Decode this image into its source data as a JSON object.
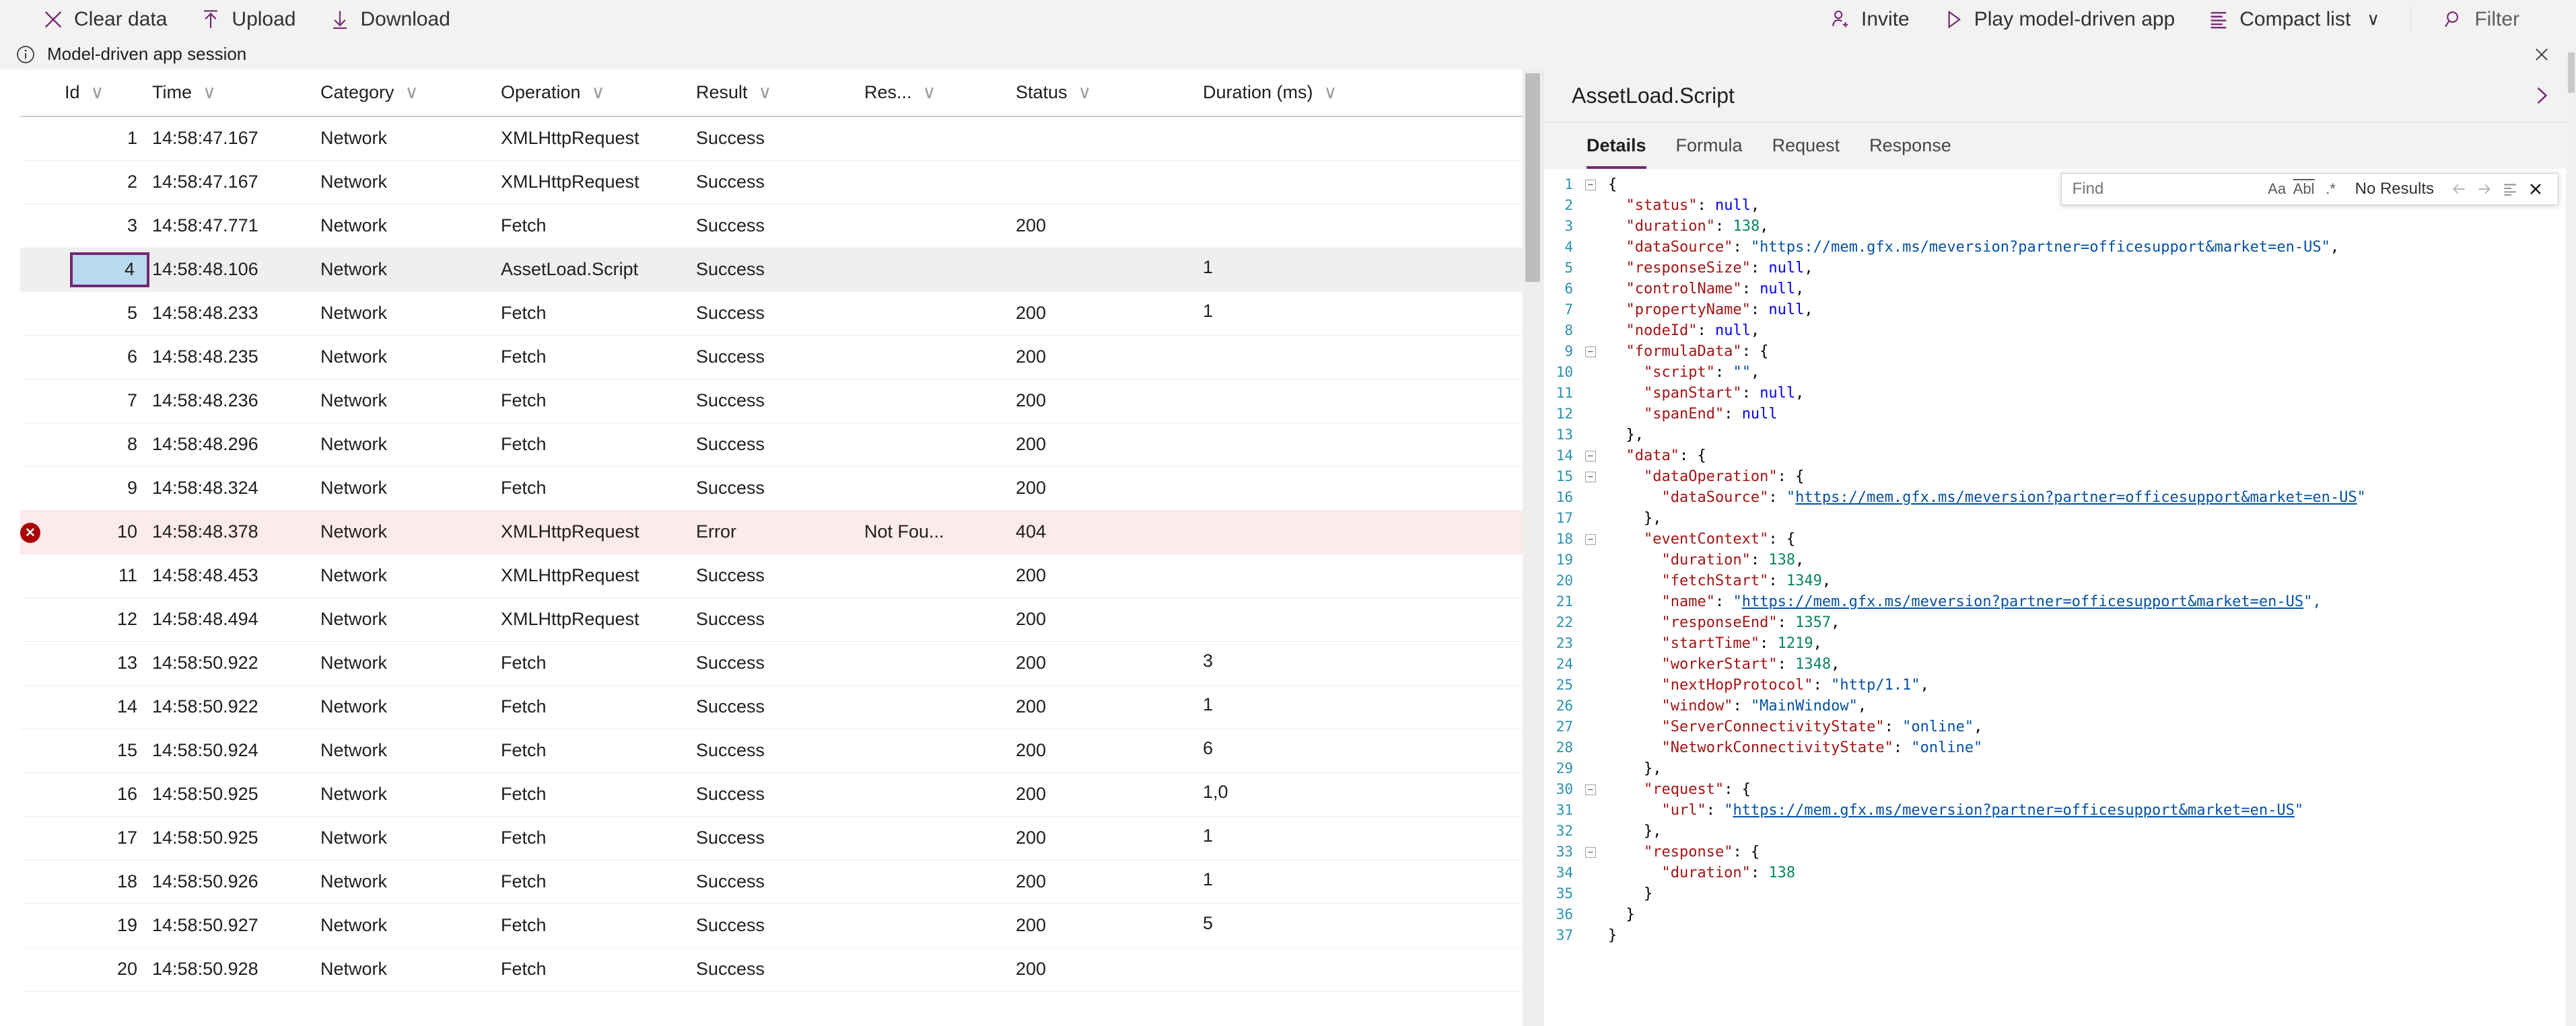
{
  "toolbar": {
    "left_items": [
      {
        "icon": "clear-icon",
        "label": "Clear data"
      },
      {
        "icon": "upload-icon",
        "label": "Upload"
      },
      {
        "icon": "download-icon",
        "label": "Download"
      }
    ],
    "right_items": [
      {
        "icon": "invite-person-icon",
        "label": "Invite"
      },
      {
        "icon": "play-icon",
        "label": "Play model-driven app"
      },
      {
        "icon": "list-icon",
        "label": "Compact list",
        "caret": "∨"
      },
      {
        "icon": "search-icon",
        "label": "Filter"
      }
    ]
  },
  "session_bar": {
    "icon": "info-icon",
    "text": "Model-driven app session",
    "close_icon": "close-icon"
  },
  "table": {
    "columns": [
      {
        "key": "err",
        "label": ""
      },
      {
        "key": "id",
        "label": "Id"
      },
      {
        "key": "time",
        "label": "Time"
      },
      {
        "key": "cat",
        "label": "Category"
      },
      {
        "key": "op",
        "label": "Operation"
      },
      {
        "key": "res",
        "label": "Result"
      },
      {
        "key": "ressz",
        "label": "Res..."
      },
      {
        "key": "stat",
        "label": "Status"
      },
      {
        "key": "dur",
        "label": "Duration (ms)"
      }
    ],
    "sort_chevron": "∨",
    "rows": [
      {
        "err": "",
        "id": "1",
        "time": "14:58:47.167",
        "cat": "Network",
        "op": "XMLHttpRequest",
        "res": "Success",
        "ressz": "",
        "stat": "",
        "dur": ""
      },
      {
        "err": "",
        "id": "2",
        "time": "14:58:47.167",
        "cat": "Network",
        "op": "XMLHttpRequest",
        "res": "Success",
        "ressz": "",
        "stat": "",
        "dur": ""
      },
      {
        "err": "",
        "id": "3",
        "time": "14:58:47.771",
        "cat": "Network",
        "op": "Fetch",
        "res": "Success",
        "ressz": "",
        "stat": "200",
        "dur": ""
      },
      {
        "err": "",
        "id": "4",
        "time": "14:58:48.106",
        "cat": "Network",
        "op": "AssetLoad.Script",
        "res": "Success",
        "ressz": "",
        "stat": "",
        "dur": "1"
      },
      {
        "err": "",
        "id": "5",
        "time": "14:58:48.233",
        "cat": "Network",
        "op": "Fetch",
        "res": "Success",
        "ressz": "",
        "stat": "200",
        "dur": "1"
      },
      {
        "err": "",
        "id": "6",
        "time": "14:58:48.235",
        "cat": "Network",
        "op": "Fetch",
        "res": "Success",
        "ressz": "",
        "stat": "200",
        "dur": ""
      },
      {
        "err": "",
        "id": "7",
        "time": "14:58:48.236",
        "cat": "Network",
        "op": "Fetch",
        "res": "Success",
        "ressz": "",
        "stat": "200",
        "dur": ""
      },
      {
        "err": "",
        "id": "8",
        "time": "14:58:48.296",
        "cat": "Network",
        "op": "Fetch",
        "res": "Success",
        "ressz": "",
        "stat": "200",
        "dur": ""
      },
      {
        "err": "",
        "id": "9",
        "time": "14:58:48.324",
        "cat": "Network",
        "op": "Fetch",
        "res": "Success",
        "ressz": "",
        "stat": "200",
        "dur": ""
      },
      {
        "err": "error-icon",
        "id": "10",
        "time": "14:58:48.378",
        "cat": "Network",
        "op": "XMLHttpRequest",
        "res": "Error",
        "ressz": "Not Fou...",
        "stat": "404",
        "dur": ""
      },
      {
        "err": "",
        "id": "11",
        "time": "14:58:48.453",
        "cat": "Network",
        "op": "XMLHttpRequest",
        "res": "Success",
        "ressz": "",
        "stat": "200",
        "dur": ""
      },
      {
        "err": "",
        "id": "12",
        "time": "14:58:48.494",
        "cat": "Network",
        "op": "XMLHttpRequest",
        "res": "Success",
        "ressz": "",
        "stat": "200",
        "dur": ""
      },
      {
        "err": "",
        "id": "13",
        "time": "14:58:50.922",
        "cat": "Network",
        "op": "Fetch",
        "res": "Success",
        "ressz": "",
        "stat": "200",
        "dur": "3"
      },
      {
        "err": "",
        "id": "14",
        "time": "14:58:50.922",
        "cat": "Network",
        "op": "Fetch",
        "res": "Success",
        "ressz": "",
        "stat": "200",
        "dur": "1"
      },
      {
        "err": "",
        "id": "15",
        "time": "14:58:50.924",
        "cat": "Network",
        "op": "Fetch",
        "res": "Success",
        "ressz": "",
        "stat": "200",
        "dur": "6"
      },
      {
        "err": "",
        "id": "16",
        "time": "14:58:50.925",
        "cat": "Network",
        "op": "Fetch",
        "res": "Success",
        "ressz": "",
        "stat": "200",
        "dur": "1,0"
      },
      {
        "err": "",
        "id": "17",
        "time": "14:58:50.925",
        "cat": "Network",
        "op": "Fetch",
        "res": "Success",
        "ressz": "",
        "stat": "200",
        "dur": "1"
      },
      {
        "err": "",
        "id": "18",
        "time": "14:58:50.926",
        "cat": "Network",
        "op": "Fetch",
        "res": "Success",
        "ressz": "",
        "stat": "200",
        "dur": "1"
      },
      {
        "err": "",
        "id": "19",
        "time": "14:58:50.927",
        "cat": "Network",
        "op": "Fetch",
        "res": "Success",
        "ressz": "",
        "stat": "200",
        "dur": "5"
      },
      {
        "err": "",
        "id": "20",
        "time": "14:58:50.928",
        "cat": "Network",
        "op": "Fetch",
        "res": "Success",
        "ressz": "",
        "stat": "200",
        "dur": ""
      }
    ],
    "selected_row_index": 3,
    "error_row_index": 9
  },
  "details": {
    "title": "AssetLoad.Script",
    "expand_icon": "chevron-right-icon",
    "tabs": [
      {
        "label": "Details",
        "active": true
      },
      {
        "label": "Formula",
        "active": false
      },
      {
        "label": "Request",
        "active": false
      },
      {
        "label": "Response",
        "active": false
      }
    ],
    "find": {
      "placeholder": "Find",
      "value": "",
      "match_case_label": "Aa",
      "whole_word_label": "Abl",
      "regex_label": ".*",
      "results_text": "No Results",
      "prev_icon": "arrow-left-icon",
      "next_icon": "arrow-right-icon",
      "find_in_selection_icon": "selection-icon",
      "close_icon": "close-icon"
    },
    "json_lines": [
      {
        "n": 1,
        "fold": "-",
        "indent": 0,
        "segs": [
          {
            "t": "{",
            "c": "p"
          }
        ]
      },
      {
        "n": 2,
        "fold": "",
        "indent": 1,
        "segs": [
          {
            "t": "  \"status\"",
            "c": "k"
          },
          {
            "t": ": ",
            "c": "p"
          },
          {
            "t": "null",
            "c": "b"
          },
          {
            "t": ",",
            "c": "p"
          }
        ]
      },
      {
        "n": 3,
        "fold": "",
        "indent": 1,
        "segs": [
          {
            "t": "  \"duration\"",
            "c": "k"
          },
          {
            "t": ": ",
            "c": "p"
          },
          {
            "t": "138",
            "c": "n"
          },
          {
            "t": ",",
            "c": "p"
          }
        ]
      },
      {
        "n": 4,
        "fold": "",
        "indent": 1,
        "segs": [
          {
            "t": "  \"dataSource\"",
            "c": "k"
          },
          {
            "t": ": ",
            "c": "p"
          },
          {
            "t": "\"https://mem.gfx.ms/meversion?partner=officesupport&market=en-US\"",
            "c": "s"
          },
          {
            "t": ",",
            "c": "p"
          }
        ]
      },
      {
        "n": 5,
        "fold": "",
        "indent": 1,
        "segs": [
          {
            "t": "  \"responseSize\"",
            "c": "k"
          },
          {
            "t": ": ",
            "c": "p"
          },
          {
            "t": "null",
            "c": "b"
          },
          {
            "t": ",",
            "c": "p"
          }
        ]
      },
      {
        "n": 6,
        "fold": "",
        "indent": 1,
        "segs": [
          {
            "t": "  \"controlName\"",
            "c": "k"
          },
          {
            "t": ": ",
            "c": "p"
          },
          {
            "t": "null",
            "c": "b"
          },
          {
            "t": ",",
            "c": "p"
          }
        ]
      },
      {
        "n": 7,
        "fold": "",
        "indent": 1,
        "segs": [
          {
            "t": "  \"propertyName\"",
            "c": "k"
          },
          {
            "t": ": ",
            "c": "p"
          },
          {
            "t": "null",
            "c": "b"
          },
          {
            "t": ",",
            "c": "p"
          }
        ]
      },
      {
        "n": 8,
        "fold": "",
        "indent": 1,
        "segs": [
          {
            "t": "  \"nodeId\"",
            "c": "k"
          },
          {
            "t": ": ",
            "c": "p"
          },
          {
            "t": "null",
            "c": "b"
          },
          {
            "t": ",",
            "c": "p"
          }
        ]
      },
      {
        "n": 9,
        "fold": "-",
        "indent": 1,
        "segs": [
          {
            "t": "  \"formulaData\"",
            "c": "k"
          },
          {
            "t": ": {",
            "c": "p"
          }
        ]
      },
      {
        "n": 10,
        "fold": "",
        "indent": 2,
        "segs": [
          {
            "t": "    \"script\"",
            "c": "k"
          },
          {
            "t": ": ",
            "c": "p"
          },
          {
            "t": "\"\"",
            "c": "s"
          },
          {
            "t": ",",
            "c": "p"
          }
        ]
      },
      {
        "n": 11,
        "fold": "",
        "indent": 2,
        "segs": [
          {
            "t": "    \"spanStart\"",
            "c": "k"
          },
          {
            "t": ": ",
            "c": "p"
          },
          {
            "t": "null",
            "c": "b"
          },
          {
            "t": ",",
            "c": "p"
          }
        ]
      },
      {
        "n": 12,
        "fold": "",
        "indent": 2,
        "segs": [
          {
            "t": "    \"spanEnd\"",
            "c": "k"
          },
          {
            "t": ": ",
            "c": "p"
          },
          {
            "t": "null",
            "c": "b"
          }
        ]
      },
      {
        "n": 13,
        "fold": "",
        "indent": 1,
        "segs": [
          {
            "t": "  },",
            "c": "p"
          }
        ]
      },
      {
        "n": 14,
        "fold": "-",
        "indent": 1,
        "segs": [
          {
            "t": "  \"data\"",
            "c": "k"
          },
          {
            "t": ": {",
            "c": "p"
          }
        ]
      },
      {
        "n": 15,
        "fold": "-",
        "indent": 2,
        "segs": [
          {
            "t": "    \"dataOperation\"",
            "c": "k"
          },
          {
            "t": ": {",
            "c": "p"
          }
        ]
      },
      {
        "n": 16,
        "fold": "",
        "indent": 3,
        "segs": [
          {
            "t": "      \"dataSource\"",
            "c": "k"
          },
          {
            "t": ": ",
            "c": "p"
          },
          {
            "t": "\"",
            "c": "s"
          },
          {
            "t": "https://mem.gfx.ms/meversion?partner=officesupport&market=en-US",
            "c": "lnk"
          },
          {
            "t": "\"",
            "c": "s"
          }
        ]
      },
      {
        "n": 17,
        "fold": "",
        "indent": 2,
        "segs": [
          {
            "t": "    },",
            "c": "p"
          }
        ]
      },
      {
        "n": 18,
        "fold": "-",
        "indent": 2,
        "segs": [
          {
            "t": "    \"eventContext\"",
            "c": "k"
          },
          {
            "t": ": {",
            "c": "p"
          }
        ]
      },
      {
        "n": 19,
        "fold": "",
        "indent": 3,
        "segs": [
          {
            "t": "      \"duration\"",
            "c": "k"
          },
          {
            "t": ": ",
            "c": "p"
          },
          {
            "t": "138",
            "c": "n"
          },
          {
            "t": ",",
            "c": "p"
          }
        ]
      },
      {
        "n": 20,
        "fold": "",
        "indent": 3,
        "segs": [
          {
            "t": "      \"fetchStart\"",
            "c": "k"
          },
          {
            "t": ": ",
            "c": "p"
          },
          {
            "t": "1349",
            "c": "n"
          },
          {
            "t": ",",
            "c": "p"
          }
        ]
      },
      {
        "n": 21,
        "fold": "",
        "indent": 3,
        "segs": [
          {
            "t": "      \"name\"",
            "c": "k"
          },
          {
            "t": ": ",
            "c": "p"
          },
          {
            "t": "\"",
            "c": "s"
          },
          {
            "t": "https://mem.gfx.ms/meversion?partner=officesupport&market=en-US",
            "c": "lnk"
          },
          {
            "t": "\",",
            "c": "s"
          }
        ]
      },
      {
        "n": 22,
        "fold": "",
        "indent": 3,
        "segs": [
          {
            "t": "      \"responseEnd\"",
            "c": "k"
          },
          {
            "t": ": ",
            "c": "p"
          },
          {
            "t": "1357",
            "c": "n"
          },
          {
            "t": ",",
            "c": "p"
          }
        ]
      },
      {
        "n": 23,
        "fold": "",
        "indent": 3,
        "segs": [
          {
            "t": "      \"startTime\"",
            "c": "k"
          },
          {
            "t": ": ",
            "c": "p"
          },
          {
            "t": "1219",
            "c": "n"
          },
          {
            "t": ",",
            "c": "p"
          }
        ]
      },
      {
        "n": 24,
        "fold": "",
        "indent": 3,
        "segs": [
          {
            "t": "      \"workerStart\"",
            "c": "k"
          },
          {
            "t": ": ",
            "c": "p"
          },
          {
            "t": "1348",
            "c": "n"
          },
          {
            "t": ",",
            "c": "p"
          }
        ]
      },
      {
        "n": 25,
        "fold": "",
        "indent": 3,
        "segs": [
          {
            "t": "      \"nextHopProtocol\"",
            "c": "k"
          },
          {
            "t": ": ",
            "c": "p"
          },
          {
            "t": "\"http/1.1\"",
            "c": "s"
          },
          {
            "t": ",",
            "c": "p"
          }
        ]
      },
      {
        "n": 26,
        "fold": "",
        "indent": 3,
        "segs": [
          {
            "t": "      \"window\"",
            "c": "k"
          },
          {
            "t": ": ",
            "c": "p"
          },
          {
            "t": "\"MainWindow\"",
            "c": "s"
          },
          {
            "t": ",",
            "c": "p"
          }
        ]
      },
      {
        "n": 27,
        "fold": "",
        "indent": 3,
        "segs": [
          {
            "t": "      \"ServerConnectivityState\"",
            "c": "k"
          },
          {
            "t": ": ",
            "c": "p"
          },
          {
            "t": "\"online\"",
            "c": "s"
          },
          {
            "t": ",",
            "c": "p"
          }
        ]
      },
      {
        "n": 28,
        "fold": "",
        "indent": 3,
        "segs": [
          {
            "t": "      \"NetworkConnectivityState\"",
            "c": "k"
          },
          {
            "t": ": ",
            "c": "p"
          },
          {
            "t": "\"online\"",
            "c": "s"
          }
        ]
      },
      {
        "n": 29,
        "fold": "",
        "indent": 2,
        "segs": [
          {
            "t": "    },",
            "c": "p"
          }
        ]
      },
      {
        "n": 30,
        "fold": "-",
        "indent": 2,
        "segs": [
          {
            "t": "    \"request\"",
            "c": "k"
          },
          {
            "t": ": {",
            "c": "p"
          }
        ]
      },
      {
        "n": 31,
        "fold": "",
        "indent": 3,
        "segs": [
          {
            "t": "      \"url\"",
            "c": "k"
          },
          {
            "t": ": ",
            "c": "p"
          },
          {
            "t": "\"",
            "c": "s"
          },
          {
            "t": "https://mem.gfx.ms/meversion?partner=officesupport&market=en-US",
            "c": "lnk"
          },
          {
            "t": "\"",
            "c": "s"
          }
        ]
      },
      {
        "n": 32,
        "fold": "",
        "indent": 2,
        "segs": [
          {
            "t": "    },",
            "c": "p"
          }
        ]
      },
      {
        "n": 33,
        "fold": "-",
        "indent": 2,
        "segs": [
          {
            "t": "    \"response\"",
            "c": "k"
          },
          {
            "t": ": {",
            "c": "p"
          }
        ]
      },
      {
        "n": 34,
        "fold": "",
        "indent": 3,
        "segs": [
          {
            "t": "      \"duration\"",
            "c": "k"
          },
          {
            "t": ": ",
            "c": "p"
          },
          {
            "t": "138",
            "c": "n"
          }
        ]
      },
      {
        "n": 35,
        "fold": "",
        "indent": 2,
        "segs": [
          {
            "t": "    }",
            "c": "p"
          }
        ]
      },
      {
        "n": 36,
        "fold": "",
        "indent": 1,
        "segs": [
          {
            "t": "  }",
            "c": "p"
          }
        ]
      },
      {
        "n": 37,
        "fold": "",
        "indent": 0,
        "segs": [
          {
            "t": "}",
            "c": "p"
          }
        ]
      }
    ]
  },
  "colors": {
    "accent_purple": "#742774",
    "error_red": "#a80000",
    "error_row_bg": "#fdeaec",
    "selection_blue": "#b9d9ee",
    "chrome_gray": "#f3f2f1"
  }
}
